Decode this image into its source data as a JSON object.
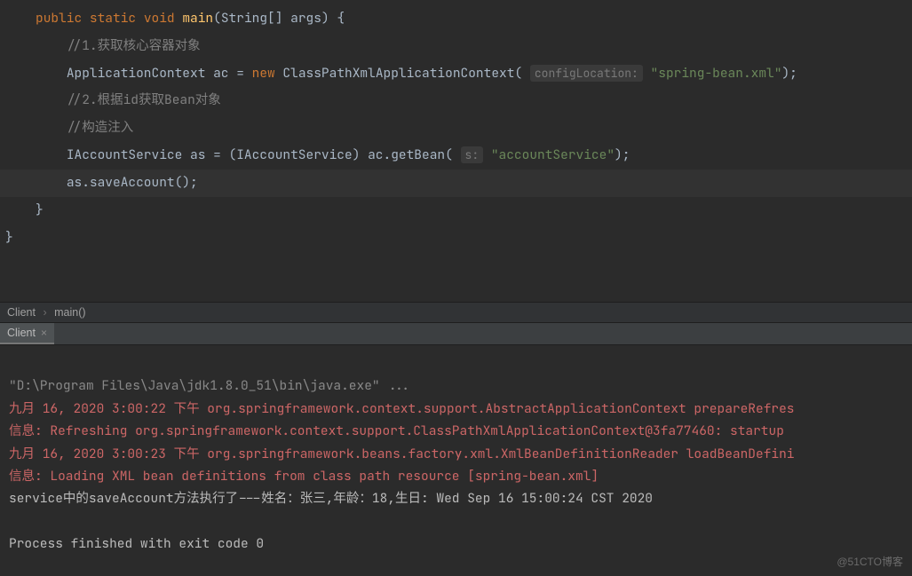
{
  "code": {
    "l1": {
      "indent": "    ",
      "kw_public": "public",
      "kw_static": "static",
      "kw_void": "void",
      "method": "main",
      "params": "(String[] args) {"
    },
    "l2": "//1.获取核心容器对象",
    "l3": {
      "decl": "ApplicationContext ac = ",
      "kw_new": "new",
      "cls": " ClassPathXmlApplicationContext( ",
      "hint": "configLocation:",
      "str": " \"spring-bean.xml\"",
      "end": ");"
    },
    "l4": "//2.根据id获取Bean对象",
    "l5": "//构造注入",
    "l6": {
      "decl": "IAccountService as = (IAccountService) ac.getBean( ",
      "hint": "s:",
      "str": " \"accountService\"",
      "end": ");"
    },
    "l7": "as.saveAccount();",
    "l8": "}",
    "l9": "}"
  },
  "breadcrumb": {
    "item1": "Client",
    "item2": "main()"
  },
  "tab": {
    "label": "Client"
  },
  "console": {
    "l1": "\"D:\\Program Files\\Java\\jdk1.8.0_51\\bin\\java.exe\" ...",
    "l2": "九月 16, 2020 3:00:22 下午 org.springframework.context.support.AbstractApplicationContext prepareRefres",
    "l3": "信息: Refreshing org.springframework.context.support.ClassPathXmlApplicationContext@3fa77460: startup ",
    "l4": "九月 16, 2020 3:00:23 下午 org.springframework.beans.factory.xml.XmlBeanDefinitionReader loadBeanDefini",
    "l5": "信息: Loading XML bean definitions from class path resource [spring-bean.xml]",
    "l6": "service中的saveAccount方法执行了---姓名：张三,年龄：18,生日: Wed Sep 16 15:00:24 CST 2020",
    "l7": "",
    "l8": "Process finished with exit code 0"
  },
  "watermark": "@51CTO博客"
}
